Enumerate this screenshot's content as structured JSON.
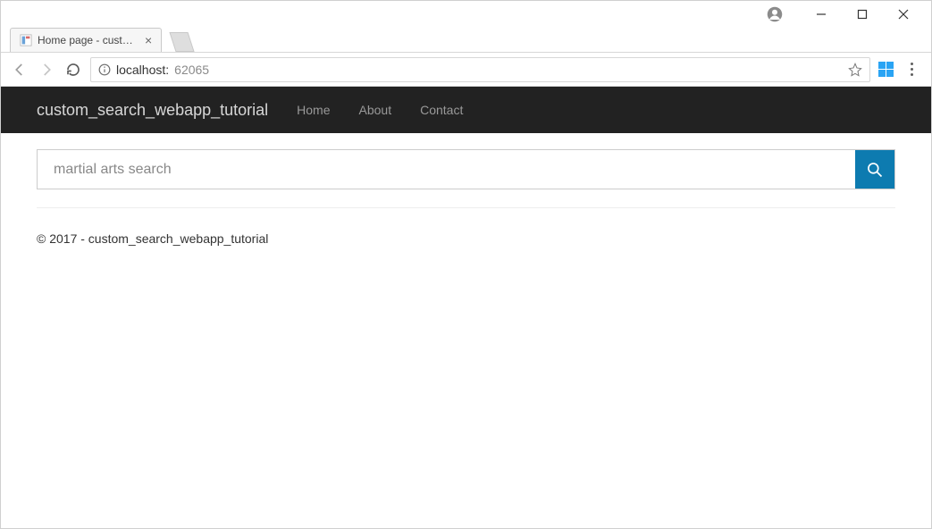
{
  "window": {
    "tab_title": "Home page - custom_se…"
  },
  "addressbar": {
    "host": "localhost:",
    "port": "62065"
  },
  "navbar": {
    "brand": "custom_search_webapp_tutorial",
    "links": [
      "Home",
      "About",
      "Contact"
    ]
  },
  "search": {
    "placeholder": "martial arts search"
  },
  "footer": {
    "text": "© 2017 - custom_search_webapp_tutorial"
  },
  "colors": {
    "accent": "#0d7bb0"
  }
}
